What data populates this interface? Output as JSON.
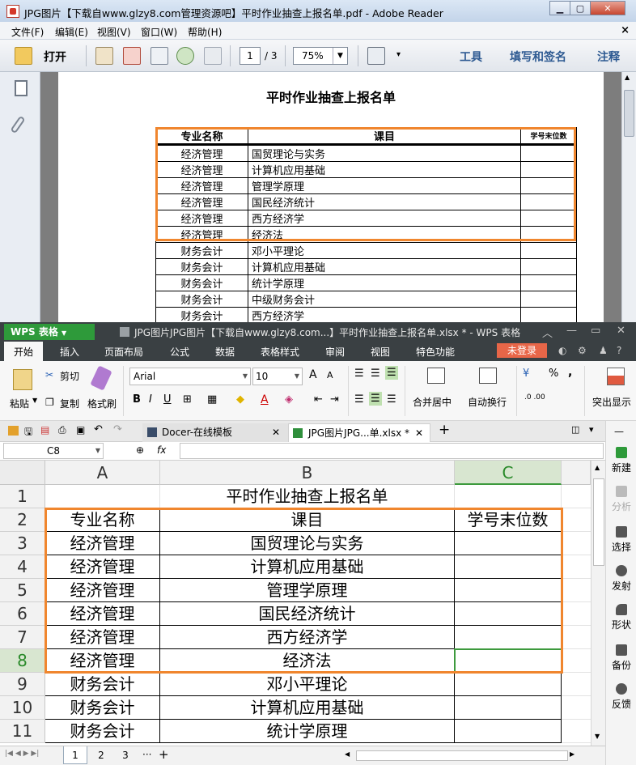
{
  "reader": {
    "title": "JPG图片【下载自www.glzy8.com管理资源吧】平时作业抽查上报名单.pdf - Adobe Reader",
    "menu": [
      "文件(F)",
      "编辑(E)",
      "视图(V)",
      "窗口(W)",
      "帮助(H)"
    ],
    "open_label": "打开",
    "page_value": "1",
    "page_total": "/ 3",
    "zoom_value": "75%",
    "right_tools": [
      "工具",
      "填写和签名",
      "注释"
    ],
    "doc_title": "平时作业抽查上报名单",
    "table": {
      "headers": [
        "专业名称",
        "课目",
        "学号末位数"
      ],
      "rows": [
        [
          "经济管理",
          "国贸理论与实务",
          ""
        ],
        [
          "经济管理",
          "计算机应用基础",
          ""
        ],
        [
          "经济管理",
          "管理学原理",
          ""
        ],
        [
          "经济管理",
          "国民经济统计",
          ""
        ],
        [
          "经济管理",
          "西方经济学",
          ""
        ],
        [
          "经济管理",
          "经济法",
          ""
        ],
        [
          "财务会计",
          "邓小平理论",
          ""
        ],
        [
          "财务会计",
          "计算机应用基础",
          ""
        ],
        [
          "财务会计",
          "统计学原理",
          ""
        ],
        [
          "财务会计",
          "中级财务会计",
          ""
        ],
        [
          "财务会计",
          "西方经济学",
          ""
        ]
      ]
    }
  },
  "wps": {
    "logo": "WPS 表格",
    "title": "JPG图片JPG图片【下载自www.glzy8.com...】平时作业抽查上报名单.xlsx * - WPS 表格",
    "tabs": [
      "开始",
      "插入",
      "页面布局",
      "公式",
      "数据",
      "表格样式",
      "审阅",
      "视图",
      "特色功能"
    ],
    "login": "未登录",
    "ribbon": {
      "cut": "剪切",
      "paste": "粘贴",
      "copy": "复制",
      "format_painter": "格式刷",
      "font": "Arial",
      "size": "10",
      "merge_center": "合并居中",
      "wrap": "自动换行",
      "highlight": "突出显示",
      "percent": "%",
      "comma": ","
    },
    "doc_tabs": [
      "Docer-在线模板",
      "JPG图片JPG...单.xlsx *"
    ],
    "name_box": "C8",
    "fx": "fx",
    "columns": [
      "A",
      "B",
      "C"
    ],
    "row_numbers": [
      "1",
      "2",
      "3",
      "4",
      "5",
      "6",
      "7",
      "8",
      "9",
      "10",
      "11"
    ],
    "rows": [
      [
        "",
        "平时作业抽查上报名单",
        ""
      ],
      [
        "专业名称",
        "课目",
        "学号末位数"
      ],
      [
        "经济管理",
        "国贸理论与实务",
        ""
      ],
      [
        "经济管理",
        "计算机应用基础",
        ""
      ],
      [
        "经济管理",
        "管理学原理",
        ""
      ],
      [
        "经济管理",
        "国民经济统计",
        ""
      ],
      [
        "经济管理",
        "西方经济学",
        ""
      ],
      [
        "经济管理",
        "经济法",
        ""
      ],
      [
        "财务会计",
        "邓小平理论",
        ""
      ],
      [
        "财务会计",
        "计算机应用基础",
        ""
      ],
      [
        "财务会计",
        "统计学原理",
        ""
      ]
    ],
    "sheet_tabs": [
      "1",
      "2",
      "3"
    ],
    "side_panel": [
      "新建",
      "分析",
      "选择",
      "发射",
      "形状",
      "备份",
      "反馈"
    ]
  },
  "colors": {
    "highlight_box": "#f0862e",
    "wps_green": "#2e9a3a",
    "login_red": "#e86648"
  }
}
